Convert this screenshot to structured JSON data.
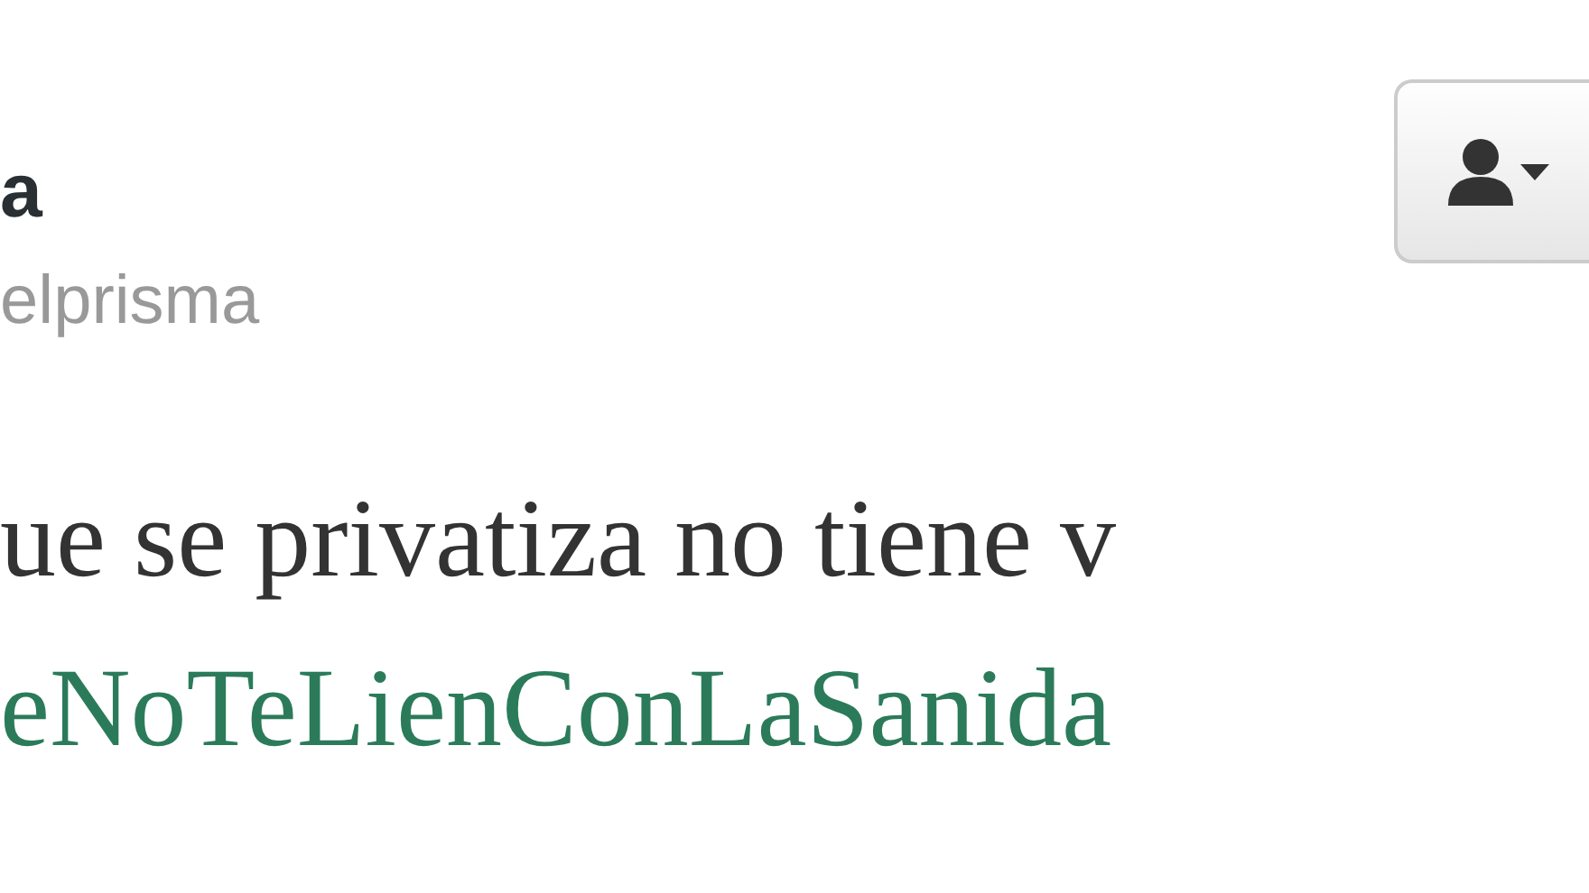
{
  "author": {
    "name": "a",
    "handle": "elprisma"
  },
  "follow_button": {
    "kind": "user-menu"
  },
  "tweet": {
    "lines": [
      {
        "kind": "text",
        "text": "ue se privatiza no tiene v"
      },
      {
        "kind": "hashtag",
        "text": "eNoTeLienConLaSanida"
      }
    ]
  }
}
